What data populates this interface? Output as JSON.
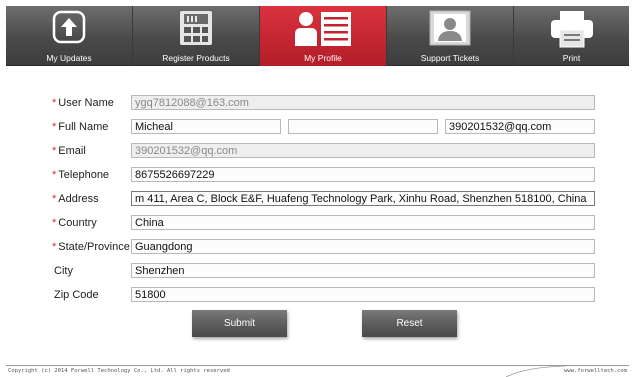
{
  "nav": {
    "items": [
      {
        "label": "My Updates",
        "icon": "updates-arrow-icon",
        "active": false
      },
      {
        "label": "Register Products",
        "icon": "calculator-icon",
        "active": false
      },
      {
        "label": "My Profile",
        "icon": "profile-icon",
        "active": true
      },
      {
        "label": "Support Tickets",
        "icon": "support-person-icon",
        "active": false
      },
      {
        "label": "Print",
        "icon": "printer-icon",
        "active": false
      }
    ]
  },
  "form": {
    "required_mark": "*",
    "username": {
      "label": "User Name",
      "value": "ygq7812088@163.com"
    },
    "fullname": {
      "label": "Full Name",
      "first": "Micheal",
      "middle": "",
      "last": "390201532@qq.com"
    },
    "email": {
      "label": "Email",
      "value": "390201532@qq.com"
    },
    "telephone": {
      "label": "Telephone",
      "value": "8675526697229"
    },
    "address": {
      "label": "Address",
      "value": "m 411, Area C, Block E&F, Huafeng Technology Park, Xinhu Road, Shenzhen 518100, China"
    },
    "country": {
      "label": "Country",
      "value": "China"
    },
    "state": {
      "label": "State/Province",
      "value": "Guangdong"
    },
    "city": {
      "label": "City",
      "value": "Shenzhen"
    },
    "zip": {
      "label": "Zip Code",
      "value": "51800"
    }
  },
  "buttons": {
    "submit": "Submit",
    "reset": "Reset"
  },
  "footer": {
    "copyright": "Copyright (c) 2014 Forwell Technology Co., Ltd. All rights reserved",
    "site": "www.forwelltech.com"
  },
  "colors": {
    "accent": "#c8262f",
    "nav_bg": "#4a4a4a",
    "required": "#d22b36"
  }
}
